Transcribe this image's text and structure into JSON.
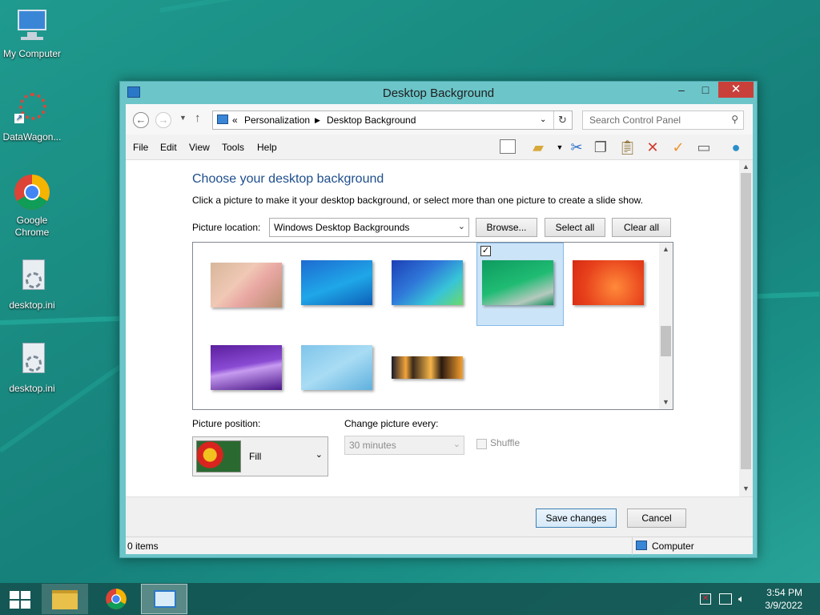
{
  "desktop": {
    "icons": [
      {
        "label": "My Computer"
      },
      {
        "label": "DataWagon..."
      },
      {
        "label": "Google Chrome"
      },
      {
        "label": "desktop.ini"
      },
      {
        "label": "desktop.ini"
      }
    ]
  },
  "window": {
    "title": "Desktop Background",
    "controls": {
      "minimize": "–",
      "maximize": "□",
      "close": "✕"
    }
  },
  "address": {
    "prefix": "«",
    "crumbs": [
      "Personalization",
      "Desktop Background"
    ],
    "search_placeholder": "Search Control Panel"
  },
  "menu": [
    "File",
    "Edit",
    "View",
    "Tools",
    "Help"
  ],
  "content": {
    "heading": "Choose your desktop background",
    "subtext": "Click a picture to make it your desktop background, or select more than one picture to create a slide show.",
    "picture_location_label": "Picture location:",
    "picture_location_value": "Windows Desktop Backgrounds",
    "browse_label": "Browse...",
    "select_all_label": "Select all",
    "clear_all_label": "Clear all",
    "thumbnails": [
      {
        "name": "cartoon",
        "selected": false
      },
      {
        "name": "blue-lines",
        "selected": false
      },
      {
        "name": "blue-petals",
        "selected": false
      },
      {
        "name": "green",
        "selected": true
      },
      {
        "name": "red-orange",
        "selected": false
      },
      {
        "name": "purple",
        "selected": false
      },
      {
        "name": "light-blue",
        "selected": false
      },
      {
        "name": "city-night",
        "selected": false
      }
    ],
    "picture_position_label": "Picture position:",
    "picture_position_value": "Fill",
    "change_picture_label": "Change picture every:",
    "change_picture_value": "30 minutes",
    "shuffle_label": "Shuffle"
  },
  "footer": {
    "save_label": "Save changes",
    "cancel_label": "Cancel"
  },
  "status": {
    "items": "0 items",
    "location": "Computer"
  },
  "taskbar": {
    "time": "3:54 PM",
    "date": "3/9/2022"
  }
}
